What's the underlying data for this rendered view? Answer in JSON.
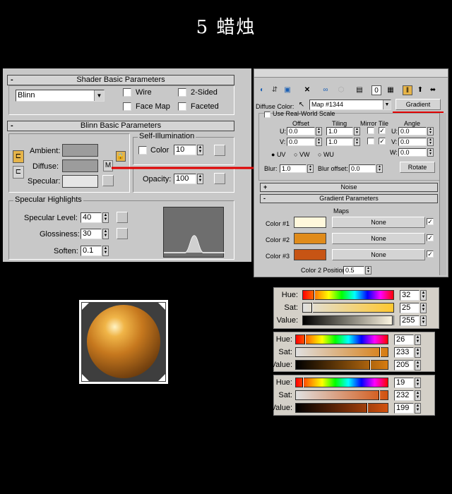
{
  "title": "5 蜡烛",
  "shader": {
    "header": "Shader Basic Parameters",
    "shader_type": "Blinn",
    "wire": "Wire",
    "two_sided": "2-Sided",
    "face_map": "Face Map",
    "faceted": "Faceted"
  },
  "blinn": {
    "header": "Blinn Basic Parameters",
    "ambient": "Ambient:",
    "diffuse": "Diffuse:",
    "specular": "Specular:",
    "m_button": "M",
    "self_illum_title": "Self-Illumination",
    "color_label": "Color",
    "color_value": "10",
    "opacity_label": "Opacity:",
    "opacity_value": "100"
  },
  "specular": {
    "group_title": "Specular Highlights",
    "level_label": "Specular Level:",
    "level_value": "40",
    "gloss_label": "Glossiness:",
    "gloss_value": "30",
    "soften_label": "Soften:",
    "soften_value": "0.1"
  },
  "map_panel": {
    "diffuse_color_label": "Diffuse Color:",
    "map_name": "Map #1344",
    "map_type": "Gradient",
    "use_real_world": "Use Real-World Scale",
    "col_offset": "Offset",
    "col_tiling": "Tiling",
    "col_mirror_tile": "Mirror Tile",
    "col_angle": "Angle",
    "u_label": "U:",
    "v_label": "V:",
    "w_label": "W:",
    "u_offset": "0.0",
    "v_offset": "0.0",
    "u_tiling": "1.0",
    "v_tiling": "1.0",
    "u_angle": "0.0",
    "v_angle": "0.0",
    "w_angle": "0.0",
    "uv": "UV",
    "vw": "VW",
    "wu": "WU",
    "blur_label": "Blur:",
    "blur_value": "1.0",
    "blur_offset_label": "Blur offset:",
    "blur_offset_value": "0.0",
    "rotate": "Rotate",
    "noise_header": "Noise",
    "gradient_header": "Gradient Parameters",
    "maps_label": "Maps",
    "color1_label": "Color #1",
    "color2_label": "Color #2",
    "color3_label": "Color #3",
    "none": "None",
    "color2_pos_label": "Color 2 Position:",
    "color2_pos_value": "0.5",
    "plus": "+",
    "minus": "-"
  },
  "colors": {
    "color1": "#fff8dc",
    "color2": "#e08b1a",
    "color3": "#c75414",
    "ambient": "#9c9c9c",
    "diffuse": "#9c9c9c",
    "specular": "#e6e6e6",
    "accent_red": "#e00000"
  },
  "hsv": [
    {
      "hue_label": "Hue:",
      "sat_label": "Sat:",
      "val_label": "Value:",
      "hue": "32",
      "sat": "25",
      "val": "255",
      "hue_level": 0.125,
      "sat_level": 0.098,
      "val_level": 1.0,
      "sat_color": "#ffc830",
      "val_color": "#fff8e4"
    },
    {
      "hue_label": "Hue:",
      "sat_label": "Sat:",
      "val_label": "Value:",
      "hue": "26",
      "sat": "233",
      "val": "205",
      "hue_level": 0.102,
      "sat_level": 0.914,
      "val_level": 0.804,
      "sat_color": "#d77c11",
      "val_color": "#d77c11"
    },
    {
      "hue_label": "Hue:",
      "sat_label": "Sat:",
      "val_label": "Value:",
      "hue": "19",
      "sat": "232",
      "val": "199",
      "hue_level": 0.075,
      "sat_level": 0.91,
      "val_level": 0.78,
      "sat_color": "#d2520f",
      "val_color": "#d2520f"
    }
  ]
}
